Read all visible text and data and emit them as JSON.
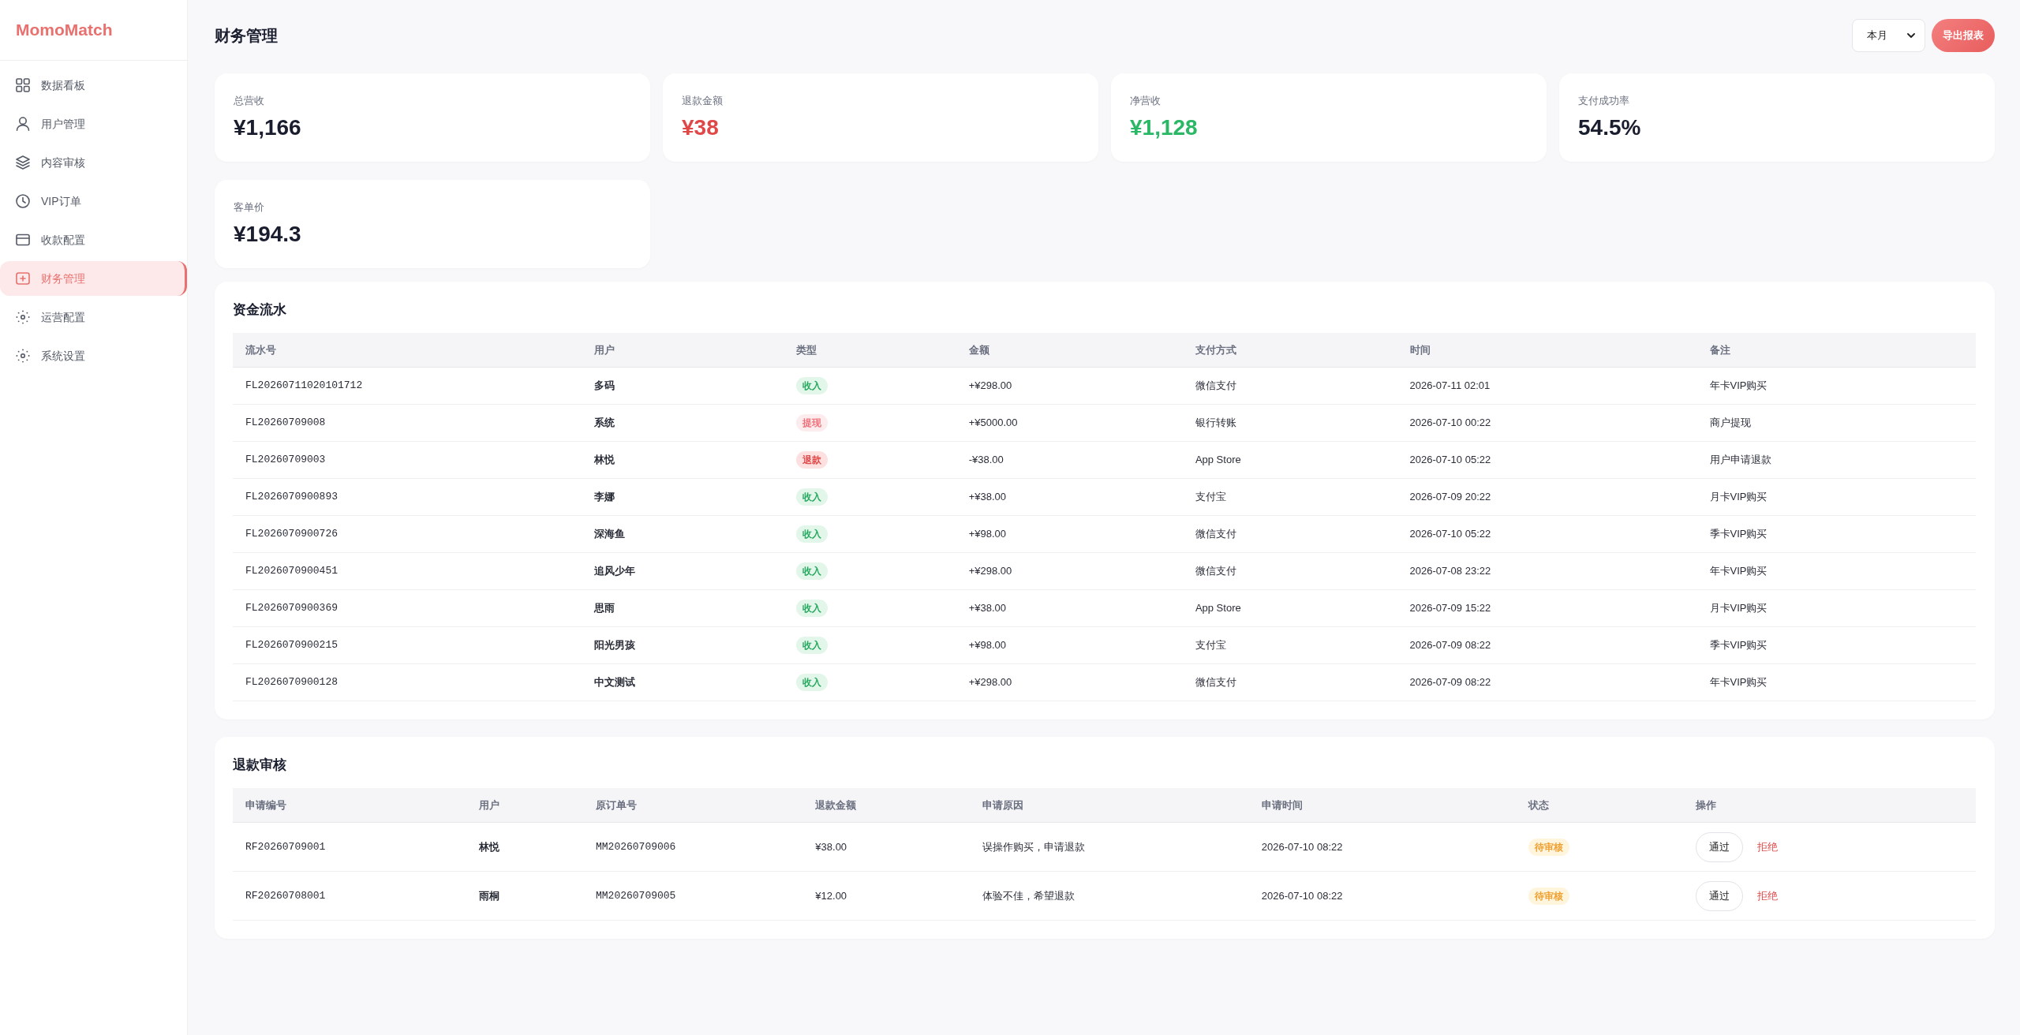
{
  "sidebar": {
    "logo": "MomoMatch",
    "items": [
      {
        "label": "数据看板",
        "selected": false
      },
      {
        "label": "用户管理",
        "selected": false
      },
      {
        "label": "内容审核",
        "selected": false
      },
      {
        "label": "VIP订单",
        "selected": false
      },
      {
        "label": "收款配置",
        "selected": false
      },
      {
        "label": "财务管理",
        "selected": true
      },
      {
        "label": "运营配置",
        "selected": false
      },
      {
        "label": "系统设置",
        "selected": false
      }
    ]
  },
  "header": {
    "title": "财务管理",
    "period_select": {
      "value": "本月"
    },
    "export_button": "导出报表"
  },
  "stats": [
    {
      "label": "总营收",
      "value": "¥1,166",
      "color": "#1a1d2e"
    },
    {
      "label": "退款金额",
      "value": "¥38",
      "color": "#e04848"
    },
    {
      "label": "净营收",
      "value": "¥1,128",
      "color": "#2bb866"
    },
    {
      "label": "支付成功率",
      "value": "54.5%",
      "color": "#1a1d2e"
    },
    {
      "label": "客单价",
      "value": "¥194.3",
      "color": "#1a1d2e"
    }
  ],
  "cash_flow": {
    "title": "资金流水",
    "columns": [
      "流水号",
      "用户",
      "类型",
      "金额",
      "支付方式",
      "时间",
      "备注"
    ],
    "rows": [
      {
        "serial": "FL20260711020101712",
        "user": "多码",
        "type": {
          "label": "收入",
          "kind": "income"
        },
        "amount": "+¥298.00",
        "payment_method": "微信支付",
        "time": "2026-07-11 02:01",
        "note": "年卡VIP购买"
      },
      {
        "serial": "FL20260709008",
        "user": "系统",
        "type": {
          "label": "提现",
          "kind": "withdraw"
        },
        "amount": "+¥5000.00",
        "payment_method": "银行转账",
        "time": "2026-07-10 00:22",
        "note": "商户提现"
      },
      {
        "serial": "FL20260709003",
        "user": "林悦",
        "type": {
          "label": "退款",
          "kind": "refund"
        },
        "amount": "-¥38.00",
        "payment_method": "App Store",
        "time": "2026-07-10 05:22",
        "note": "用户申请退款"
      },
      {
        "serial": "FL2026070900893",
        "user": "李娜",
        "type": {
          "label": "收入",
          "kind": "income"
        },
        "amount": "+¥38.00",
        "payment_method": "支付宝",
        "time": "2026-07-09 20:22",
        "note": "月卡VIP购买"
      },
      {
        "serial": "FL2026070900726",
        "user": "深海鱼",
        "type": {
          "label": "收入",
          "kind": "income"
        },
        "amount": "+¥98.00",
        "payment_method": "微信支付",
        "time": "2026-07-10 05:22",
        "note": "季卡VIP购买"
      },
      {
        "serial": "FL2026070900451",
        "user": "追风少年",
        "type": {
          "label": "收入",
          "kind": "income"
        },
        "amount": "+¥298.00",
        "payment_method": "微信支付",
        "time": "2026-07-08 23:22",
        "note": "年卡VIP购买"
      },
      {
        "serial": "FL2026070900369",
        "user": "思雨",
        "type": {
          "label": "收入",
          "kind": "income"
        },
        "amount": "+¥38.00",
        "payment_method": "App Store",
        "time": "2026-07-09 15:22",
        "note": "月卡VIP购买"
      },
      {
        "serial": "FL2026070900215",
        "user": "阳光男孩",
        "type": {
          "label": "收入",
          "kind": "income"
        },
        "amount": "+¥98.00",
        "payment_method": "支付宝",
        "time": "2026-07-09 08:22",
        "note": "季卡VIP购买"
      },
      {
        "serial": "FL2026070900128",
        "user": "中文测试",
        "type": {
          "label": "收入",
          "kind": "income"
        },
        "amount": "+¥298.00",
        "payment_method": "微信支付",
        "time": "2026-07-09 08:22",
        "note": "年卡VIP购买"
      }
    ]
  },
  "refund_review": {
    "title": "退款审核",
    "columns": [
      "申请编号",
      "用户",
      "原订单号",
      "退款金额",
      "申请原因",
      "申请时间",
      "状态",
      "操作"
    ],
    "rows": [
      {
        "request_id": "RF20260709001",
        "user": "林悦",
        "order_id": "MM20260709006",
        "amount": "¥38.00",
        "reason": "误操作购买，申请退款",
        "time": "2026-07-10 08:22",
        "status": {
          "label": "待审核",
          "kind": "pending"
        },
        "actions": [
          {
            "label": "通过",
            "kind": "approve"
          },
          {
            "label": "拒绝",
            "kind": "reject"
          }
        ]
      },
      {
        "request_id": "RF20260708001",
        "user": "雨桐",
        "order_id": "MM20260709005",
        "amount": "¥12.00",
        "reason": "体验不佳，希望退款",
        "time": "2026-07-10 08:22",
        "status": {
          "label": "待审核",
          "kind": "pending"
        },
        "actions": [
          {
            "label": "通过",
            "kind": "approve"
          },
          {
            "label": "拒绝",
            "kind": "reject"
          }
        ]
      }
    ]
  }
}
